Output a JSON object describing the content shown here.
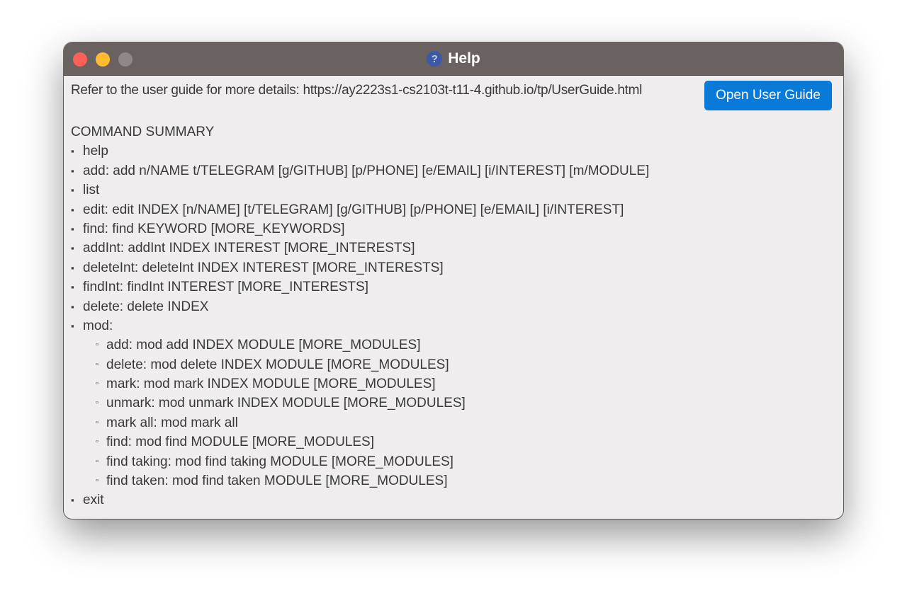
{
  "window": {
    "title": "Help",
    "title_icon": "question-mark-icon"
  },
  "guide": {
    "text": "Refer to the user guide for more details: https://ay2223s1-cs2103t-t11-4.github.io/tp/UserGuide.html",
    "button_label": "Open User Guide"
  },
  "summary": {
    "title": "COMMAND SUMMARY",
    "bullet": "▪",
    "sub_bullet": "▫",
    "commands": [
      "help",
      "add: add n/NAME t/TELEGRAM [g/GITHUB] [p/PHONE] [e/EMAIL] [i/INTEREST] [m/MODULE]",
      "list",
      "edit: edit INDEX [n/NAME] [t/TELEGRAM] [g/GITHUB] [p/PHONE] [e/EMAIL] [i/INTEREST]",
      "find: find KEYWORD [MORE_KEYWORDS]",
      "addInt: addInt INDEX INTEREST [MORE_INTERESTS]",
      "deleteInt: deleteInt INDEX INTEREST [MORE_INTERESTS]",
      "findInt: findInt INTEREST [MORE_INTERESTS]",
      "delete: delete INDEX",
      "mod:",
      "exit"
    ],
    "mod_subcommands": [
      "add: mod add INDEX MODULE [MORE_MODULES]",
      "delete: mod delete INDEX MODULE [MORE_MODULES]",
      "mark: mod mark INDEX MODULE [MORE_MODULES]",
      "unmark: mod unmark INDEX MODULE [MORE_MODULES]",
      "mark all: mod mark all",
      "find: mod find MODULE [MORE_MODULES]",
      "find taking: mod find taking MODULE [MORE_MODULES]",
      "find taken: mod find taken MODULE [MORE_MODULES]"
    ]
  },
  "colors": {
    "titlebar": "#6a6260",
    "window_bg": "#efedee",
    "button_bg": "#0a7ad8",
    "close": "#fe5f57",
    "minimize": "#febc2e",
    "zoom_inactive": "#8e8886"
  }
}
